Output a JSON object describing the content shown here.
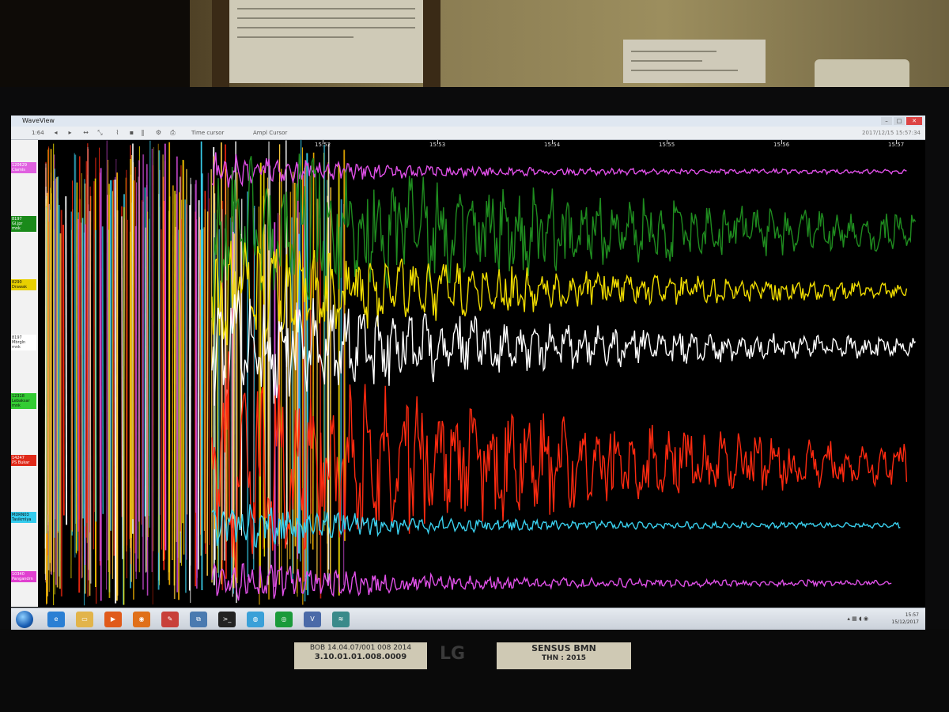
{
  "window": {
    "title": "WaveView",
    "controls": {
      "minimize": "–",
      "maximize": "□",
      "close": "✕"
    }
  },
  "toolbar": {
    "zoom_value": "1:64",
    "time_cursor_label": "Time cursor",
    "ampl_cursor_label": "Ampl Cursor",
    "datetime": "2017/12/15 15:57:34",
    "icons": [
      "arrow-left-icon",
      "arrow-right-icon",
      "arrow-lr-icon",
      "shrink-icon",
      "pause-icon",
      "filter-icon",
      "print-icon"
    ]
  },
  "time_axis": {
    "ticks": [
      "15:52",
      "15:53",
      "15:54",
      "15:55",
      "15:56",
      "15:57"
    ]
  },
  "channels": [
    {
      "code": "120629",
      "name": "Ciamis",
      "color": "#e060e0"
    },
    {
      "code": "8197",
      "name": "Gl.jpr",
      "name2": "mnk",
      "color": "#1a8a1a"
    },
    {
      "code": "8290",
      "name": "Drawak",
      "color": "#e8d000"
    },
    {
      "code": "8197",
      "name": "Mbrgln",
      "name2": "mnk",
      "color": "#ffffff"
    },
    {
      "code": "12318",
      "name": "Lebaksar",
      "name2": "mnk",
      "color": "#33cc33"
    },
    {
      "code": "14247",
      "name": "PS Bukar",
      "color": "#e02a1a"
    },
    {
      "code": "MDRN03",
      "name": "Tasikmlya",
      "color": "#33ccee"
    },
    {
      "code": "10340",
      "name": "Pangandrn",
      "color": "#e040d0"
    }
  ],
  "taskbar": {
    "apps": [
      {
        "icon": "ie-icon",
        "color": "#2a7fd4"
      },
      {
        "icon": "folder-icon",
        "color": "#e2b44a"
      },
      {
        "icon": "media-player-icon",
        "color": "#e05a1a"
      },
      {
        "icon": "firefox-icon",
        "color": "#e0701a"
      },
      {
        "icon": "paint-icon",
        "color": "#c8403a"
      },
      {
        "icon": "network-icon",
        "color": "#4a7ab0"
      },
      {
        "icon": "terminal-icon",
        "color": "#222222"
      },
      {
        "icon": "globe-icon",
        "color": "#3aa0d8"
      },
      {
        "icon": "eye-icon",
        "color": "#1a9a3a"
      },
      {
        "icon": "vnc-icon",
        "color": "#4a6aa8"
      },
      {
        "icon": "chart-icon",
        "color": "#3a8a8a"
      }
    ],
    "clock_time": "15:57",
    "clock_date": "15/12/2017"
  },
  "bezel": {
    "sticker_left_line1": "BOB 14.04.07/001 008 2014",
    "sticker_left_line2": "3.10.01.01.008.0009",
    "sticker_right_line1": "SENSUS BMN",
    "sticker_right_line2": "THN : 2015",
    "brand": "LG"
  },
  "colors": {
    "magenta": "#e050e8",
    "green": "#1f8c1f",
    "yellow": "#f0dc00",
    "white": "#ffffff",
    "red": "#ff2a10",
    "cyan": "#3ad0ee",
    "orange": "#f0b000"
  }
}
